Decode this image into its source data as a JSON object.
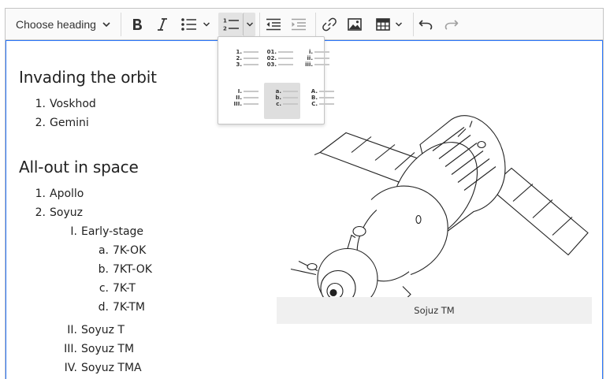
{
  "toolbar": {
    "heading_label": "Choose heading",
    "buttons": [
      "bold-icon",
      "italic-icon",
      "bulleted-list-icon",
      "numbered-list-icon",
      "outdent-icon",
      "indent-icon",
      "link-icon",
      "image-icon",
      "table-icon",
      "undo-icon",
      "redo-icon"
    ]
  },
  "numbered_list_styles": [
    {
      "markers": [
        "1.",
        "2.",
        "3."
      ]
    },
    {
      "markers": [
        "01.",
        "02.",
        "03."
      ]
    },
    {
      "markers": [
        "i.",
        "ii.",
        "iii."
      ]
    },
    {
      "markers": [
        "I.",
        "II.",
        "III."
      ]
    },
    {
      "markers": [
        "a.",
        "b.",
        "c."
      ],
      "selected": true
    },
    {
      "markers": [
        "A.",
        "B.",
        "C."
      ]
    }
  ],
  "document": {
    "section1": {
      "heading": "Invading the orbit",
      "items": [
        {
          "marker": "1.",
          "text": "Voskhod"
        },
        {
          "marker": "2.",
          "text": "Gemini"
        }
      ]
    },
    "section2": {
      "heading": "All-out in space",
      "items": [
        {
          "marker": "1.",
          "text": "Apollo"
        },
        {
          "marker": "2.",
          "text": "Soyuz"
        }
      ],
      "soyuz_sub": [
        {
          "marker": "I.",
          "text": "Early-stage"
        },
        {
          "marker": "II.",
          "text": "Soyuz T"
        },
        {
          "marker": "III.",
          "text": "Soyuz TM"
        },
        {
          "marker": "IV.",
          "text": "Soyuz TMA"
        }
      ],
      "early_stage_sub": [
        {
          "marker": "a.",
          "text": "7K-OK"
        },
        {
          "marker": "b.",
          "text": "7KT-OK"
        },
        {
          "marker": "c.",
          "text": "7K-T"
        },
        {
          "marker": "d.",
          "text": "7K-TM"
        }
      ]
    },
    "figure_caption": "Sojuz TM"
  },
  "colors": {
    "focus_border": "#2977ff",
    "toolbar_bg": "#fafafa",
    "active_button": "#e3e3e3"
  }
}
